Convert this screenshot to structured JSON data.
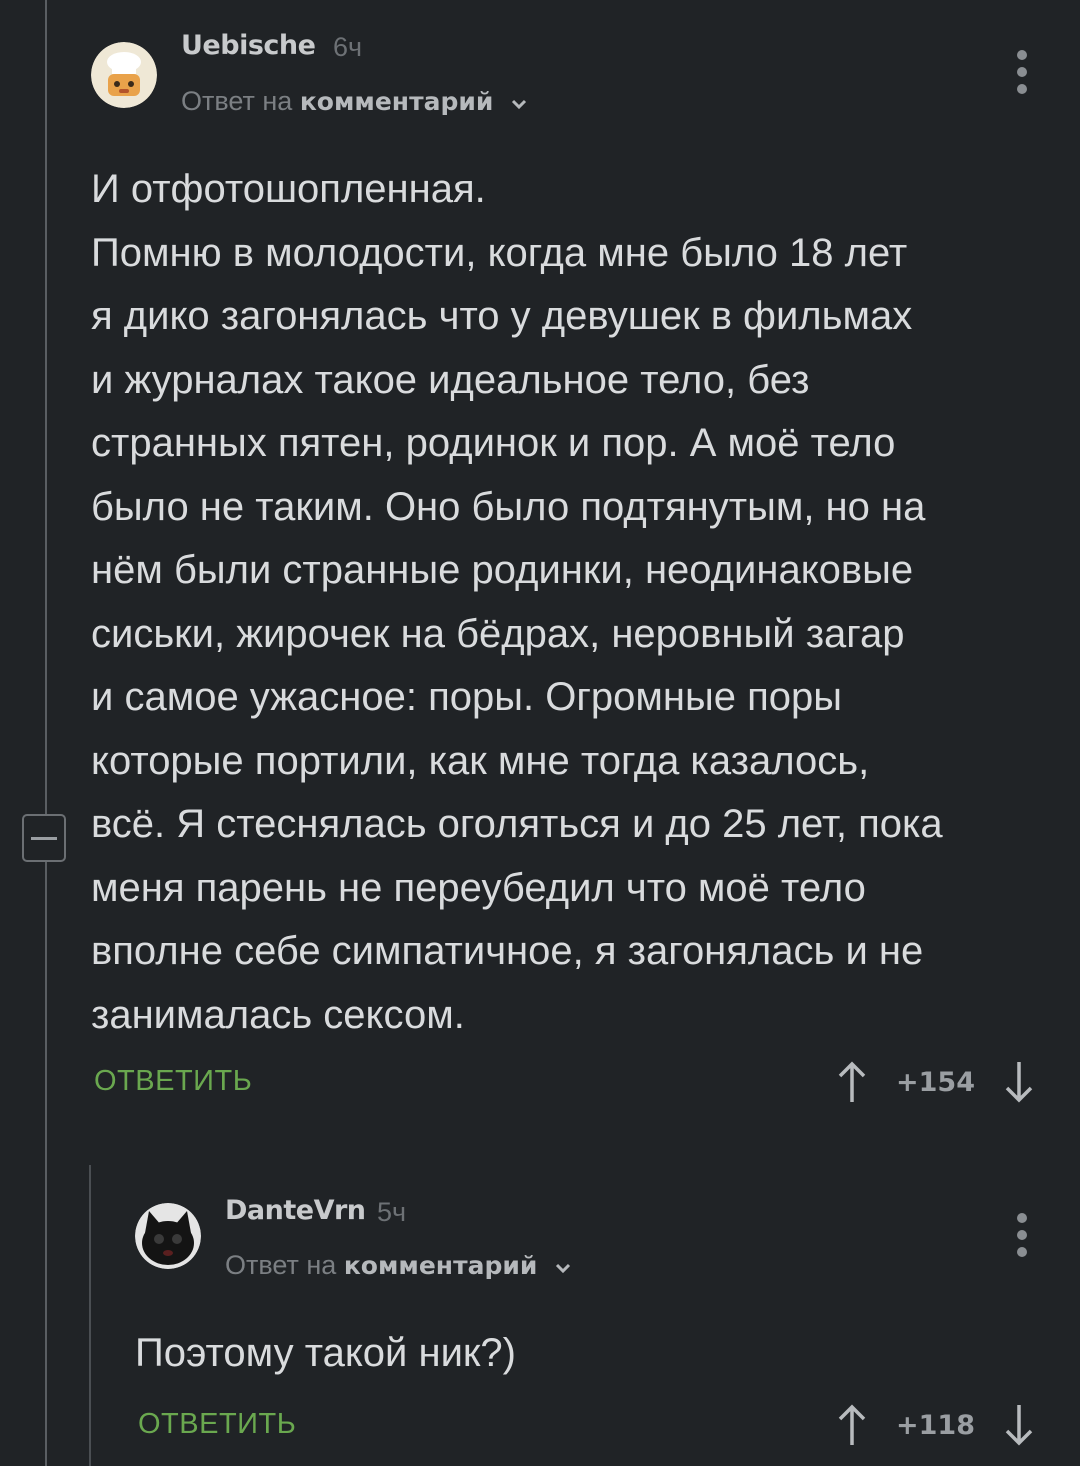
{
  "comments": [
    {
      "username": "Uebische",
      "time": "6ч",
      "reply_prefix": "Ответ на",
      "reply_link": "комментарий",
      "text": "И отфотошопленная.\nПомню в молодости, когда мне было 18 лет\nя дико загонялась что у девушек в фильмах\nи журналах такое идеальное тело, без\nстранных пятен, родинок и пор. А моё тело\nбыло не таким. Оно было подтянутым, но на\nнём были странные родинки, неодинаковые\nсиськи, жирочек на бёдрах, неровный загар\nи самое ужасное: поры. Огромные поры\nкоторые портили, как мне тогда казалось,\nвсё. Я стеснялась оголяться и до 25 лет, пока\nменя парень не переубедил что моё тело\nвполне себе симпатичное, я загонялась и не\nзанималась сексом.",
      "reply_label": "ОТВЕТИТЬ",
      "score": "+154",
      "avatar_icon": "cat-chef-avatar"
    },
    {
      "username": "DanteVrn",
      "time": "5ч",
      "reply_prefix": "Ответ на",
      "reply_link": "комментарий",
      "text": "Поэтому такой ник?)",
      "reply_label": "ОТВЕТИТЬ",
      "score": "+118",
      "avatar_icon": "black-cat-avatar"
    }
  ],
  "colors": {
    "background": "#202326",
    "reply_button": "#6aa84f",
    "text": "#d9dbdd"
  }
}
